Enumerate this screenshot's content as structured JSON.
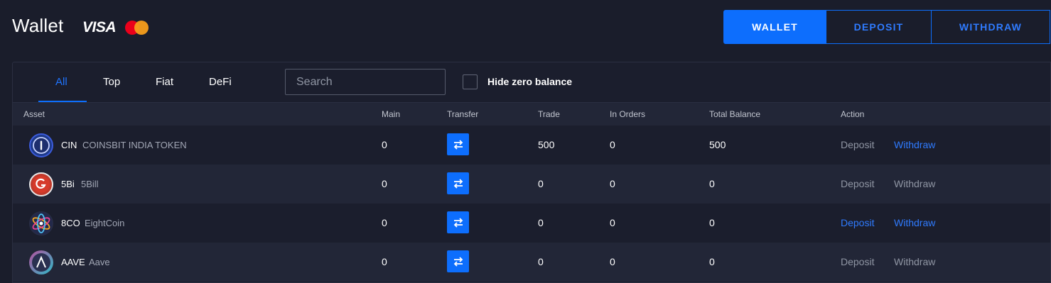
{
  "header": {
    "title": "Wallet",
    "visa_label": "VISA",
    "tabs": [
      {
        "label": "WALLET",
        "active": true
      },
      {
        "label": "DEPOSIT",
        "active": false
      },
      {
        "label": "WITHDRAW",
        "active": false
      }
    ]
  },
  "filters": {
    "items": [
      "All",
      "Top",
      "Fiat",
      "DeFi"
    ],
    "active": "All",
    "search_placeholder": "Search",
    "hide_zero_label": "Hide zero balance"
  },
  "table": {
    "columns": [
      "Asset",
      "Main",
      "Transfer",
      "Trade",
      "In Orders",
      "Total Balance",
      "Action"
    ],
    "rows": [
      {
        "symbol": "CIN",
        "name": "COINSBIT INDIA TOKEN",
        "main": "0",
        "trade": "500",
        "in_orders": "0",
        "total": "500",
        "deposit": "Deposit",
        "withdraw": "Withdraw",
        "deposit_enabled": false,
        "withdraw_enabled": true,
        "icon": "cin-coin-icon"
      },
      {
        "symbol": "5Bi",
        "name": "5Bill",
        "main": "0",
        "trade": "0",
        "in_orders": "0",
        "total": "0",
        "deposit": "Deposit",
        "withdraw": "Withdraw",
        "deposit_enabled": false,
        "withdraw_enabled": false,
        "icon": "5bi-coin-icon"
      },
      {
        "symbol": "8CO",
        "name": "EightCoin",
        "main": "0",
        "trade": "0",
        "in_orders": "0",
        "total": "0",
        "deposit": "Deposit",
        "withdraw": "Withdraw",
        "deposit_enabled": true,
        "withdraw_enabled": true,
        "icon": "8co-coin-icon"
      },
      {
        "symbol": "AAVE",
        "name": "Aave",
        "main": "0",
        "trade": "0",
        "in_orders": "0",
        "total": "0",
        "deposit": "Deposit",
        "withdraw": "Withdraw",
        "deposit_enabled": false,
        "withdraw_enabled": false,
        "icon": "aave-coin-icon"
      }
    ]
  },
  "colors": {
    "accent": "#0d6efd",
    "background": "#1a1d2b",
    "row_alt": "#222637",
    "muted_text": "#9096a4"
  }
}
